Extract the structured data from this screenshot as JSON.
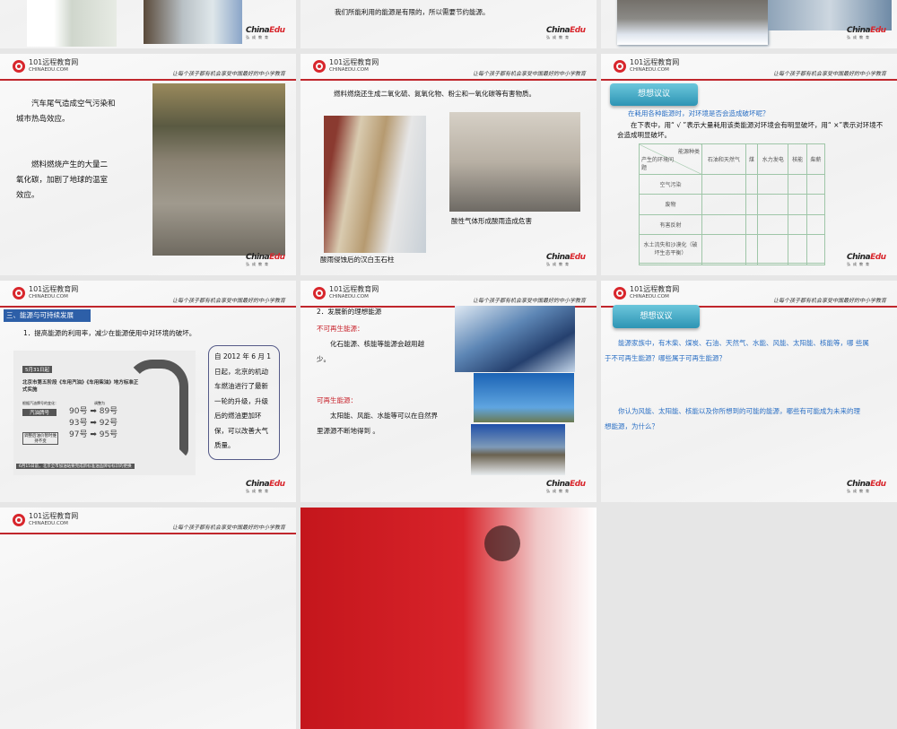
{
  "common": {
    "brand": "101远程教育网",
    "brand_domain": "CHINAEDU.COM",
    "slogan": "让每个孩子都有机会享受中国最好的中小学教育",
    "footer_logo_a": "China",
    "footer_logo_b": "Edu",
    "footer_sub": "弘成教育"
  },
  "slide_row0_b": {
    "text": "我们所能利用的能源是有限的，所以需要节约能源。"
  },
  "slide_cars": {
    "p1": "汽车尾气造成空气污染和城市热岛效应。",
    "p2": "燃料燃烧产生的大量二氧化碳，加剧了地球的温室效应。"
  },
  "slide_acid": {
    "heading": "燃料燃烧还生成二氧化硫、氮氧化物、粉尘和一氧化碳等有害物质。",
    "caption_right": "酸性气体形成酸雨造成危害",
    "caption_left": "酸雨侵蚀后的汉白玉石柱"
  },
  "slide_table": {
    "button": "想想议议",
    "question": "在耗用各种能源时，对环境是否会造成破坏呢？",
    "instruction": "在下表中，用“ √ ”表示大量耗用该类能源对环境会有明显破坏，用“ ×”表示对环境不会造成明显破坏。",
    "corner_top": "能源种类",
    "corner_bottom": "产生的环境问题",
    "columns": [
      "石油和天然气",
      "煤",
      "水力发电",
      "核能",
      "柴薪"
    ],
    "rows": [
      "空气污染",
      "废物",
      "有害反射",
      "水土流失和沙漠化（破坏生态平衡）",
      ""
    ]
  },
  "slide_fuel": {
    "section": "三、能源与可持续发展",
    "item": "1．提高能源的利用率，减少在能源使用中对环境的破坏。",
    "date_tag": "5月31日起",
    "notice": "北京市第五阶段《车用汽油》《车用柴油》地方标准正式实施",
    "change_label": "根据汽油牌号的变化：",
    "adjust_label": "调整为",
    "grade_label": "汽油牌号",
    "price_note": "调整后油价暂时维持不变",
    "grades": [
      {
        "from": "90",
        "to": "89"
      },
      {
        "from": "93",
        "to": "92"
      },
      {
        "from": "97",
        "to": "95"
      }
    ],
    "unit": "号",
    "bottom_note": "6月15日前，北京全市加油站要完成新标准油品牌号标识的更换",
    "callout": "自 2012 年 6 月 1 日起，北京的机动车燃油进行了最新一轮的升级，升级后的燃油更加环保，可以改善大气质量。"
  },
  "slide_new": {
    "item": "2．发展新的理想能源",
    "nonrenew_label": "不可再生能源：",
    "nonrenew_text": "化石能源、核能等能源会越用越少。",
    "renew_label": "可再生能源：",
    "renew_text": "太阳能、风能、水能等可以在自然界里源源不断地得到 。"
  },
  "slide_discuss": {
    "button": "想想议议",
    "q1": "能源家族中，有木柴、煤炭、石油、天然气、水能、风能、太阳能、核能等，哪 些属于不可再生能源？哪些属于可再生能源？",
    "q2": "你认为风能、太阳能、核能以及你所想到的可能的能源，哪些有可能成为未来的理想能源，为什么？"
  }
}
